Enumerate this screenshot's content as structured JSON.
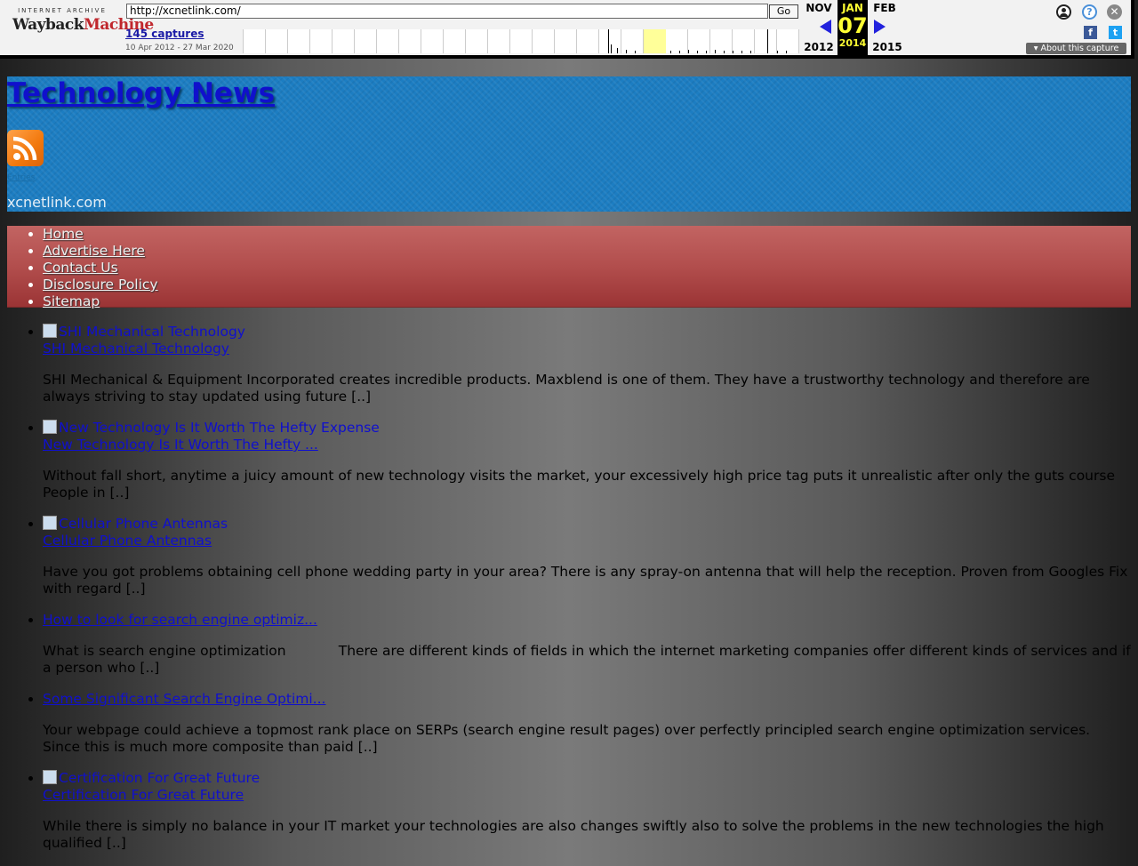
{
  "wayback": {
    "logo_top": "INTERNET ARCHIVE",
    "logo_main_a": "Wayback",
    "logo_main_b": "Machine",
    "url": "http://xcnetlink.com/",
    "go_label": "Go",
    "captures_label": "145 captures",
    "date_range": "10 Apr 2012 - 27 Mar 2020",
    "prev_month": "NOV",
    "prev_year": "2012",
    "cur_month": "JAN",
    "cur_day": "07",
    "cur_year": "2014",
    "next_month": "FEB",
    "next_year": "2015",
    "about_label": "About this capture",
    "icons": [
      "user-icon",
      "help-icon",
      "close-icon",
      "facebook-icon",
      "twitter-icon"
    ]
  },
  "header": {
    "title": "Technology News",
    "rss_label": "Entries",
    "domain": "xcnetlink.com",
    "bg_color": "#1c7dc2"
  },
  "nav": {
    "items": [
      {
        "label": "Home"
      },
      {
        "label": "Advertise Here"
      },
      {
        "label": "Contact Us"
      },
      {
        "label": "Disclosure Policy"
      },
      {
        "label": "Sitemap"
      }
    ],
    "bg_color": "#b24e4d"
  },
  "posts": [
    {
      "thumb_alt": "SHI Mechanical Technology",
      "title": "SHI Mechanical Technology",
      "excerpt": "SHI Mechanical & Equipment Incorporated creates incredible products. Maxblend is one of them. They have a trustworthy technology and therefore are always striving to stay updated using future [..]"
    },
    {
      "thumb_alt": "New Technology Is It Worth The Hefty Expense",
      "title": "New Technology Is It Worth The Hefty ...",
      "excerpt": "Without fall short, anytime a juicy amount of new technology visits the market, your excessively high price tag puts it unrealistic after only the guts course People in [..]"
    },
    {
      "thumb_alt": "Cellular Phone Antennas",
      "title": "Cellular Phone Antennas",
      "excerpt": "Have you got problems obtaining cell phone wedding party in your area? There is any spray-on antenna that will help the reception. Proven from Googles Fix with regard [..]"
    },
    {
      "thumb_alt": "",
      "title": "How to look for search engine optimiz...",
      "excerpt": "What is search engine optimization            There are different kinds of fields in which the internet marketing companies offer different kinds of services and if a person who [..]"
    },
    {
      "thumb_alt": "",
      "title": "Some Significant Search Engine Optimi...",
      "excerpt": "Your webpage could achieve a topmost rank place on SERPs (search engine result pages) over perfectly principled search engine optimization services. Since this is much more composite than paid [..]"
    },
    {
      "thumb_alt": "Certification For Great Future",
      "title": "Certification For Great Future",
      "excerpt": "While there is simply no balance in your IT market your technologies are also changes swiftly also to solve the problems in the new technologies the high qualified [..]"
    }
  ]
}
